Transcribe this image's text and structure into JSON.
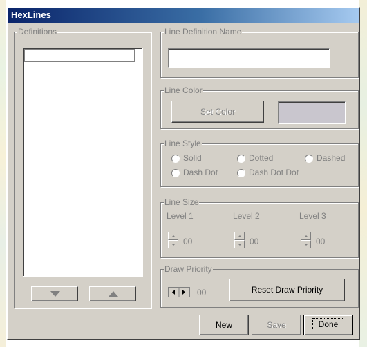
{
  "window": {
    "title": "HexLines"
  },
  "definitions": {
    "legend": "Definitions",
    "down_icon": "triangle-down-icon",
    "up_icon": "triangle-up-icon"
  },
  "line_definition_name": {
    "legend": "Line Definition Name",
    "value": ""
  },
  "line_color": {
    "legend": "Line Color",
    "set_color_label": "Set Color",
    "swatch_color": "#c9c6ce"
  },
  "line_style": {
    "legend": "Line Style",
    "options": [
      "Solid",
      "Dotted",
      "Dashed",
      "Dash Dot",
      "Dash Dot Dot"
    ]
  },
  "line_size": {
    "legend": "Line Size",
    "levels": [
      {
        "label": "Level 1",
        "value": "00"
      },
      {
        "label": "Level 2",
        "value": "00"
      },
      {
        "label": "Level 3",
        "value": "00"
      }
    ]
  },
  "draw_priority": {
    "legend": "Draw Priority",
    "value": "00",
    "reset_label": "Reset Draw Priority"
  },
  "footer": {
    "new_label": "New",
    "save_label": "Save",
    "done_label": "Done"
  }
}
